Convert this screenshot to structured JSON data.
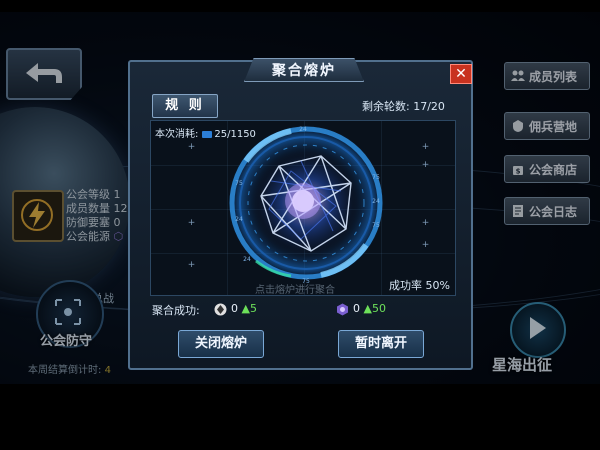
{
  "modal": {
    "title": "聚合熔炉",
    "close_label": "✕",
    "rules_tab": "规 则",
    "rounds_label": "剩余轮数:",
    "rounds_value": "17/20",
    "cost_label": "本次消耗:",
    "cost_value": "25/1150",
    "success_rate_label": "成功率",
    "success_rate_value": "50%",
    "hint_text": "点击熔炉进行聚合",
    "merge_label": "聚合成功:",
    "merge_items": [
      {
        "icon": "crystal-icon",
        "count": "0",
        "bonus": "5"
      },
      {
        "icon": "hexagon-energy-icon",
        "count": "0",
        "bonus": "50"
      }
    ],
    "close_furnace_button": "关闭熔炉",
    "leave_button": "暂时离开"
  },
  "ring_ticks": [
    "24",
    "75",
    "24",
    "75",
    "24",
    "75",
    "24",
    "75"
  ],
  "guild": {
    "rows": [
      {
        "label": "公会等级",
        "value": "1"
      },
      {
        "label": "成员数量",
        "value": "12"
      },
      {
        "label": "防御要塞",
        "value": "0"
      },
      {
        "label": "公会能源",
        "value": ""
      }
    ],
    "defense_label": "公会防守",
    "battle_label": "总战",
    "countdown_label": "本周结算倒计时:",
    "countdown_value": "4"
  },
  "side_menu": [
    {
      "label": "成员列表",
      "icon": "members-icon"
    },
    {
      "label": "佣兵营地",
      "icon": "mercenary-icon"
    },
    {
      "label": "公会商店",
      "icon": "shop-icon"
    },
    {
      "label": "公会日志",
      "icon": "log-icon"
    }
  ],
  "star_sea_label": "星海出征",
  "colors": {
    "accent": "#2f8fe0",
    "close_red": "#c8321f",
    "bonus_green": "#6de05a"
  }
}
